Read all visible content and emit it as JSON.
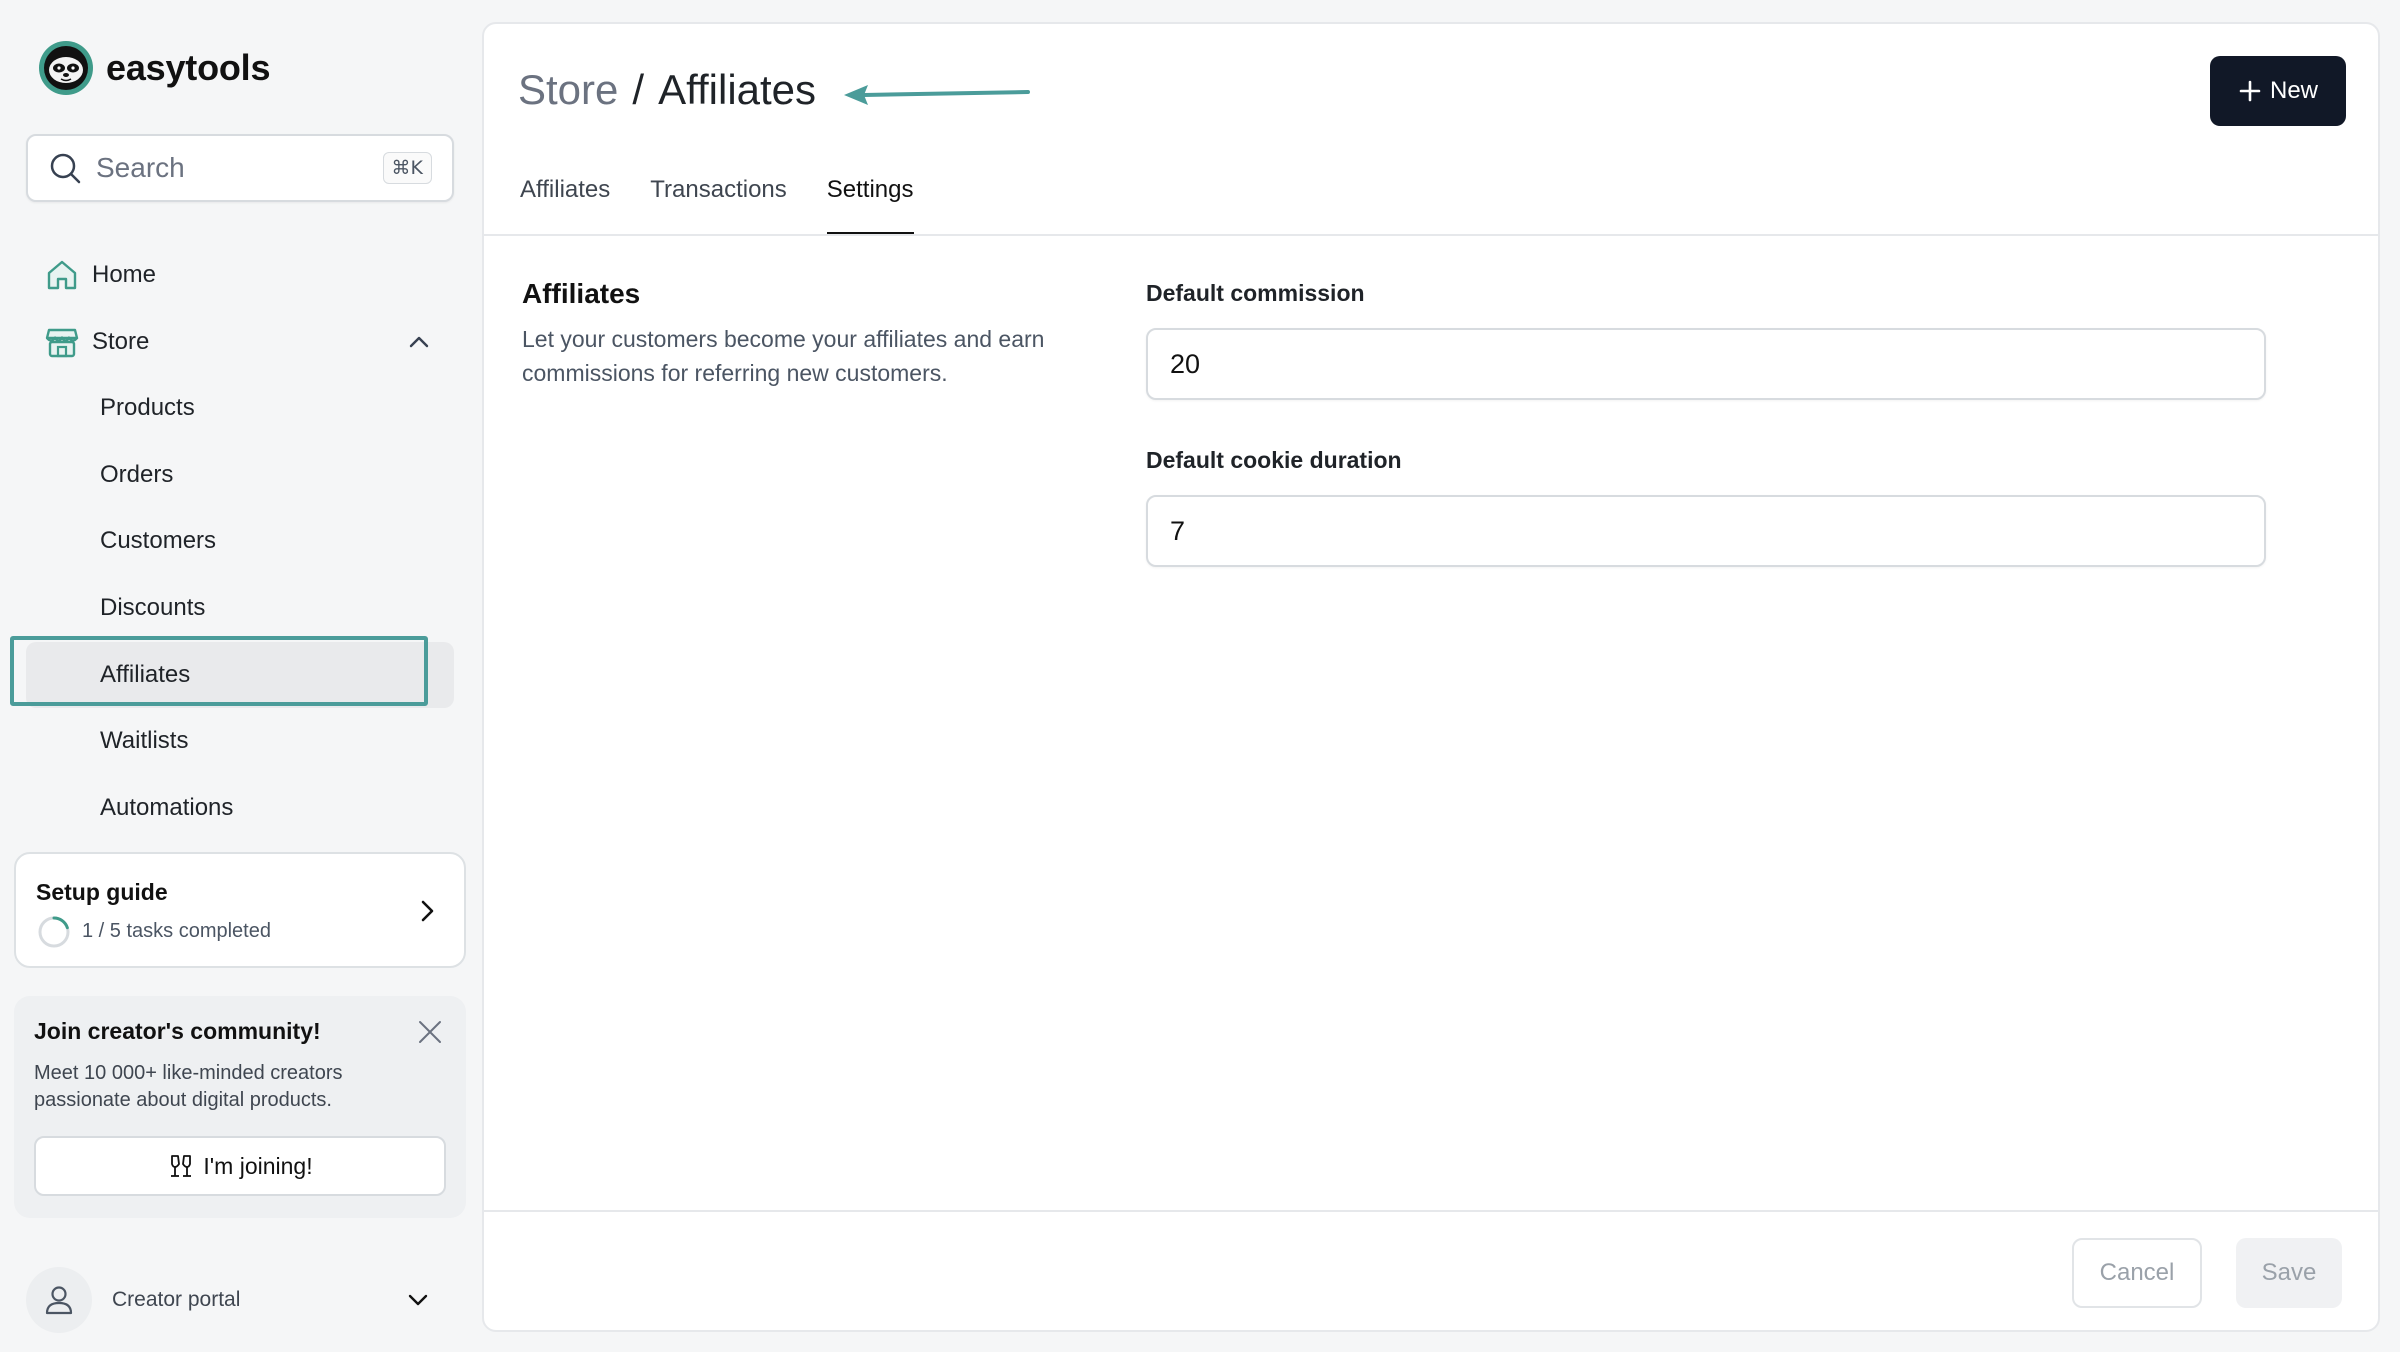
{
  "brand": {
    "name": "easytools"
  },
  "search": {
    "label": "Search",
    "shortcut": "⌘K"
  },
  "nav": {
    "home": "Home",
    "store": "Store",
    "store_items": [
      "Products",
      "Orders",
      "Customers",
      "Discounts",
      "Affiliates",
      "Waitlists",
      "Automations"
    ],
    "active_item": "Affiliates"
  },
  "setup_guide": {
    "title": "Setup guide",
    "progress": "1 / 5 tasks completed",
    "completed": 1,
    "total": 5
  },
  "community": {
    "title": "Join creator's community!",
    "description": "Meet 10 000+ like-minded creators passionate about digital products.",
    "button": "I'm joining!"
  },
  "portal": {
    "label": "Creator portal"
  },
  "header": {
    "crumb_parent": "Store",
    "crumb_separator": "/",
    "crumb_current": "Affiliates",
    "new_button": "New"
  },
  "tabs": [
    "Affiliates",
    "Transactions",
    "Settings"
  ],
  "active_tab": "Settings",
  "section": {
    "title": "Affiliates",
    "description": "Let your customers become your affiliates and earn commissions for referring new customers."
  },
  "fields": {
    "commission": {
      "label": "Default commission",
      "value": "20"
    },
    "cookie": {
      "label": "Default cookie duration",
      "value": "7"
    }
  },
  "footer": {
    "cancel": "Cancel",
    "save": "Save"
  },
  "colors": {
    "accent": "#4b9c9a",
    "primary_button": "#111827",
    "logo_green": "#3f9b8a"
  }
}
